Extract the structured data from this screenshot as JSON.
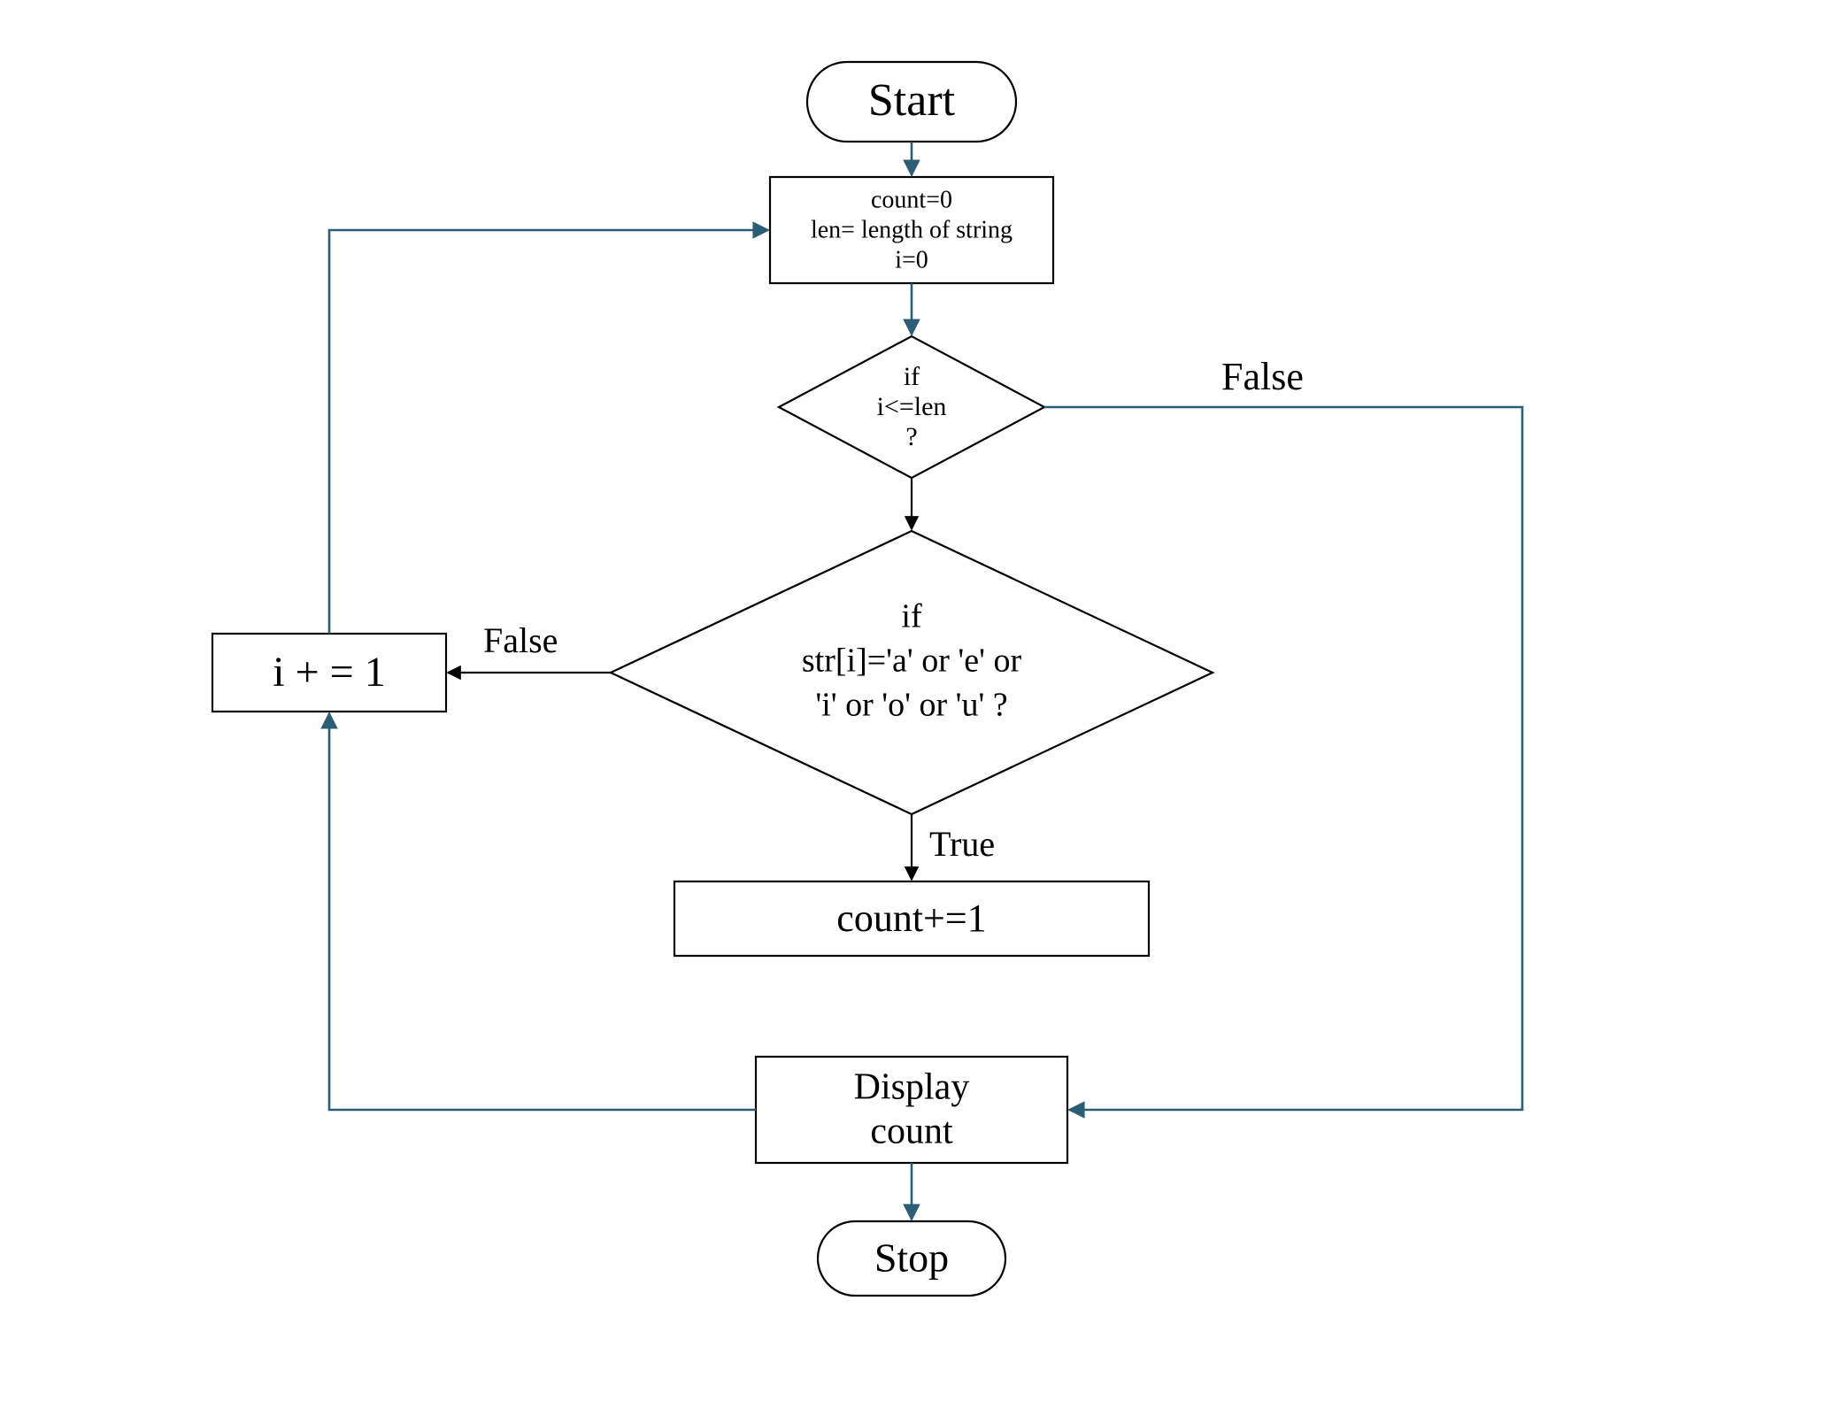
{
  "nodes": {
    "start": {
      "label": "Start"
    },
    "init": {
      "line1": "count=0",
      "line2": "len= length of string",
      "line3": "i=0"
    },
    "cond_len": {
      "line1": "if",
      "line2": "i<=len",
      "line3": "?"
    },
    "cond_vowel": {
      "line1": "if",
      "line2": "str[i]='a' or 'e' or",
      "line3": "'i' or 'o' or 'u' ?"
    },
    "inc_count": {
      "label": "count+=1"
    },
    "inc_i": {
      "label": "i + = 1"
    },
    "display": {
      "line1": "Display",
      "line2": "count"
    },
    "stop": {
      "label": "Stop"
    }
  },
  "edges": {
    "len_false": "False",
    "vowel_false": "False",
    "vowel_true": "True"
  }
}
